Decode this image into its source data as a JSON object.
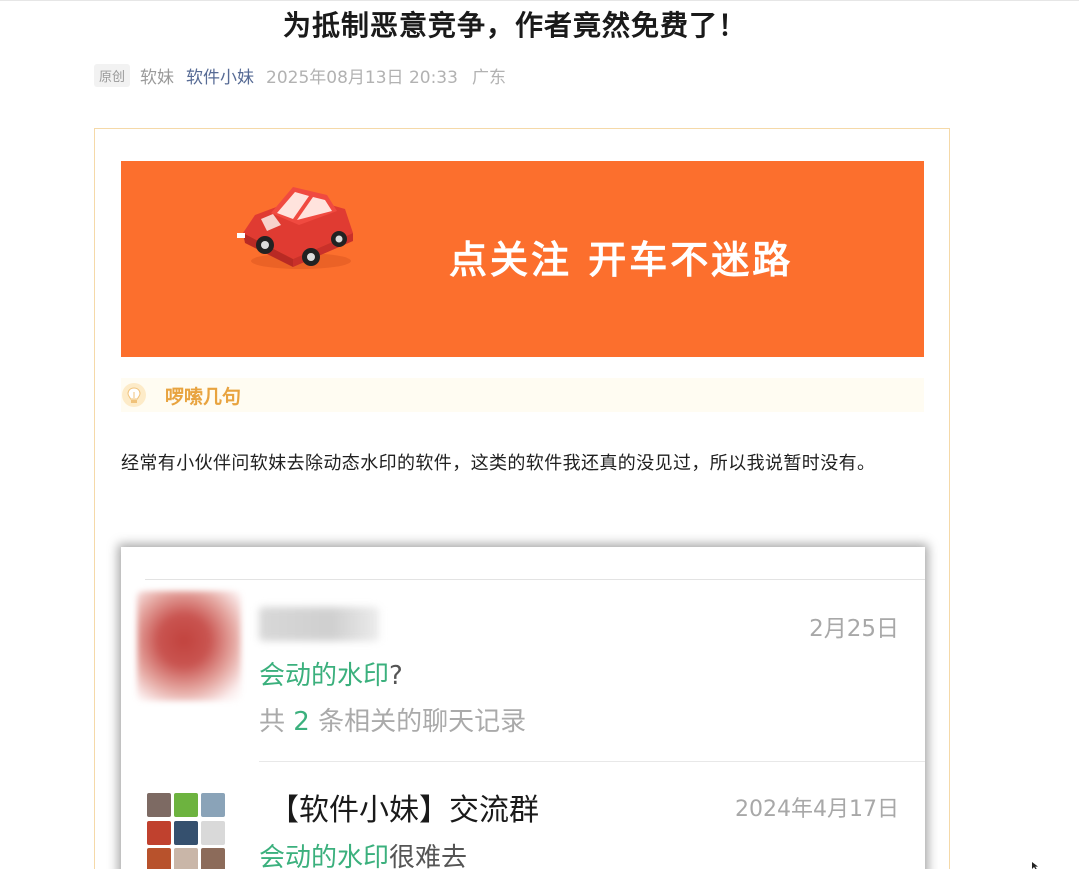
{
  "article": {
    "title": "为抵制恶意竞争，作者竟然免费了！",
    "badge": "原创",
    "author": "软妹",
    "account": "软件小妹",
    "datetime": "2025年08月13日 20:33",
    "location": "广东"
  },
  "banner": {
    "slogan": "点关注 开车不迷路",
    "background_color": "#fc6f2d",
    "icon": "red-car-icon"
  },
  "section": {
    "heading": "啰嗦几句",
    "icon": "lightbulb-icon"
  },
  "body": {
    "paragraph": "经常有小伙伴问软妹去除动态水印的软件，这类的软件我还真的没见过，所以我说暂时没有。"
  },
  "chat_results": [
    {
      "date": "2月25日",
      "highlight": "会动的水印",
      "suffix": "?",
      "count_prefix": "共",
      "count": "2",
      "count_suffix": "条相关的聊天记录"
    },
    {
      "title": "【软件小妹】交流群",
      "date": "2024年4月17日",
      "highlight": "会动的水印",
      "suffix": "很难去"
    }
  ],
  "colors": {
    "accent_green": "#3bb07d",
    "link_blue": "#576b95",
    "heading_orange": "#e8a33f"
  }
}
